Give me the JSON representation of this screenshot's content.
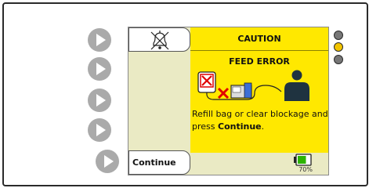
{
  "alert": {
    "level": "CAUTION",
    "title": "FEED ERROR",
    "message_prefix": "Refill bag or clear blockage and press ",
    "message_action": "Continue",
    "message_suffix": "."
  },
  "softkeys": {
    "continue_label": "Continue"
  },
  "status": {
    "battery_percent": "70%",
    "battery_level": 0.7
  },
  "colors": {
    "alert_panel": "#ffe800",
    "screen_background": "#eaeac4",
    "led_off": "#777777",
    "led_caution": "#f2c400",
    "battery_fill": "#2db300",
    "error_red": "#e00000"
  },
  "icons": {
    "alarm_silence": "bell-crossed-icon",
    "feed_error_graphic": "bag-blocked-pump-patient-icon",
    "battery": "battery-icon",
    "softkey": "play-arrow-icon"
  },
  "leds": [
    {
      "name": "led-top",
      "state": "off"
    },
    {
      "name": "led-middle",
      "state": "caution"
    },
    {
      "name": "led-bottom",
      "state": "off"
    }
  ]
}
